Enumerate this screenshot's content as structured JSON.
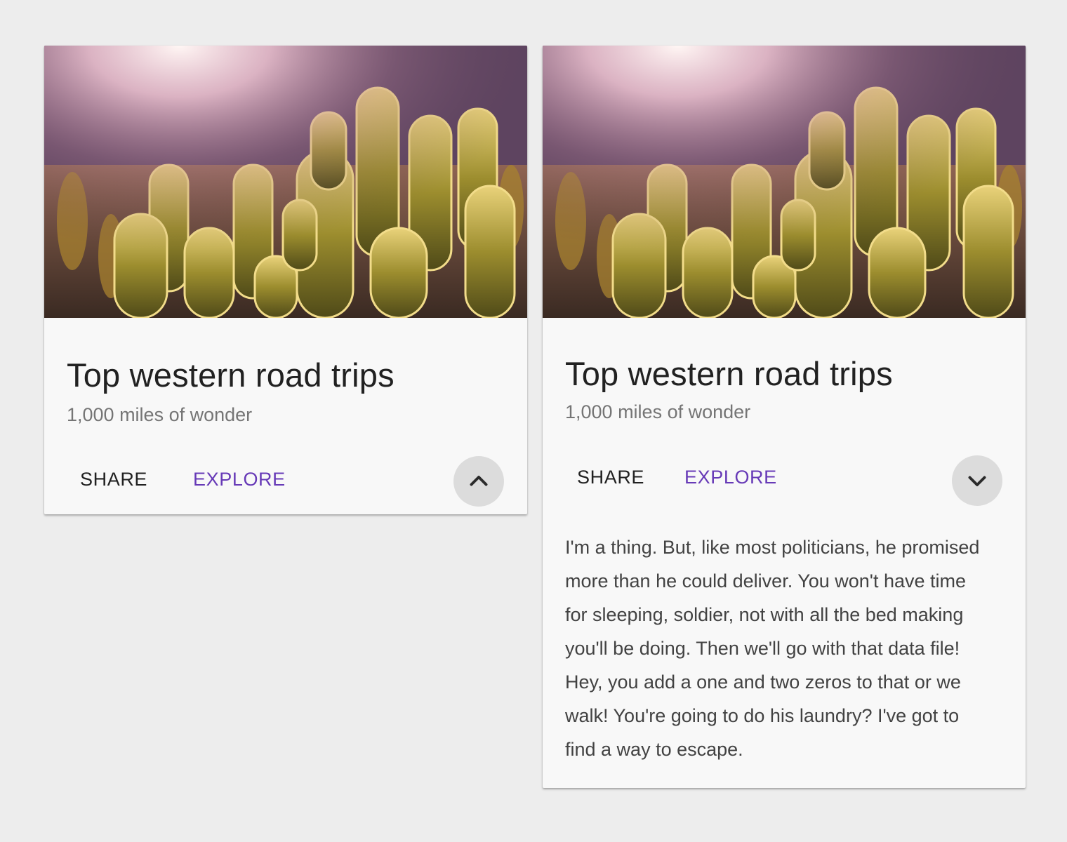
{
  "colors": {
    "background": "#ededed",
    "card": "#f8f8f8",
    "title": "#212121",
    "subtitle": "#757575",
    "accent": "#673ab7",
    "toggle_bg": "#dcdcdc"
  },
  "cards": [
    {
      "state": "collapsed",
      "image": "cactus-desert-photo",
      "title": "Top western road trips",
      "subtitle": "1,000 miles of wonder",
      "actions": {
        "share": "SHARE",
        "explore": "EXPLORE"
      },
      "toggle_icon": "chevron-up-icon"
    },
    {
      "state": "expanded",
      "image": "cactus-desert-photo",
      "title": "Top western road trips",
      "subtitle": "1,000 miles of wonder",
      "actions": {
        "share": "SHARE",
        "explore": "EXPLORE"
      },
      "toggle_icon": "chevron-down-icon",
      "body": "I'm a thing. But, like most politicians, he promised more than he could deliver. You won't have time for sleeping, soldier, not with all the bed making you'll be doing. Then we'll go with that data file! Hey, you add a one and two zeros to that or we walk! You're going to do his laundry? I've got to find a way to escape."
    }
  ]
}
